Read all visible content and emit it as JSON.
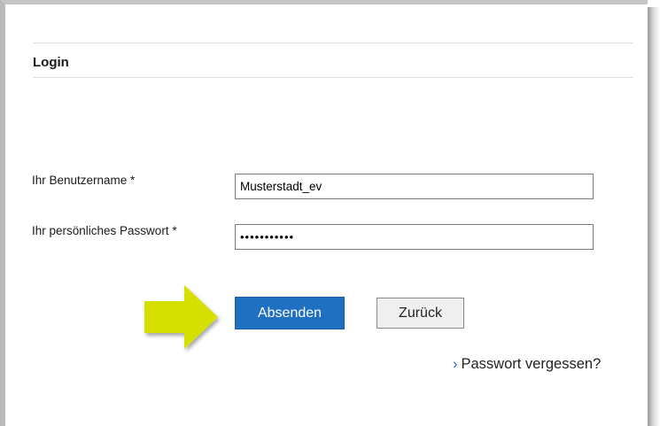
{
  "form": {
    "title": "Login",
    "username_label": "Ihr Benutzername *",
    "username_value": "Musterstadt_ev",
    "password_label": "Ihr persönliches Passwort *",
    "password_value": "•••••••••••",
    "submit_label": "Absenden",
    "back_label": "Zurück",
    "forgot_label": "Passwort vergessen?"
  },
  "icons": {
    "link_chevron": "›",
    "highlight_arrow": "arrow-right-icon"
  },
  "colors": {
    "primary_button": "#1f70c1",
    "highlight_arrow": "#d6e000"
  }
}
